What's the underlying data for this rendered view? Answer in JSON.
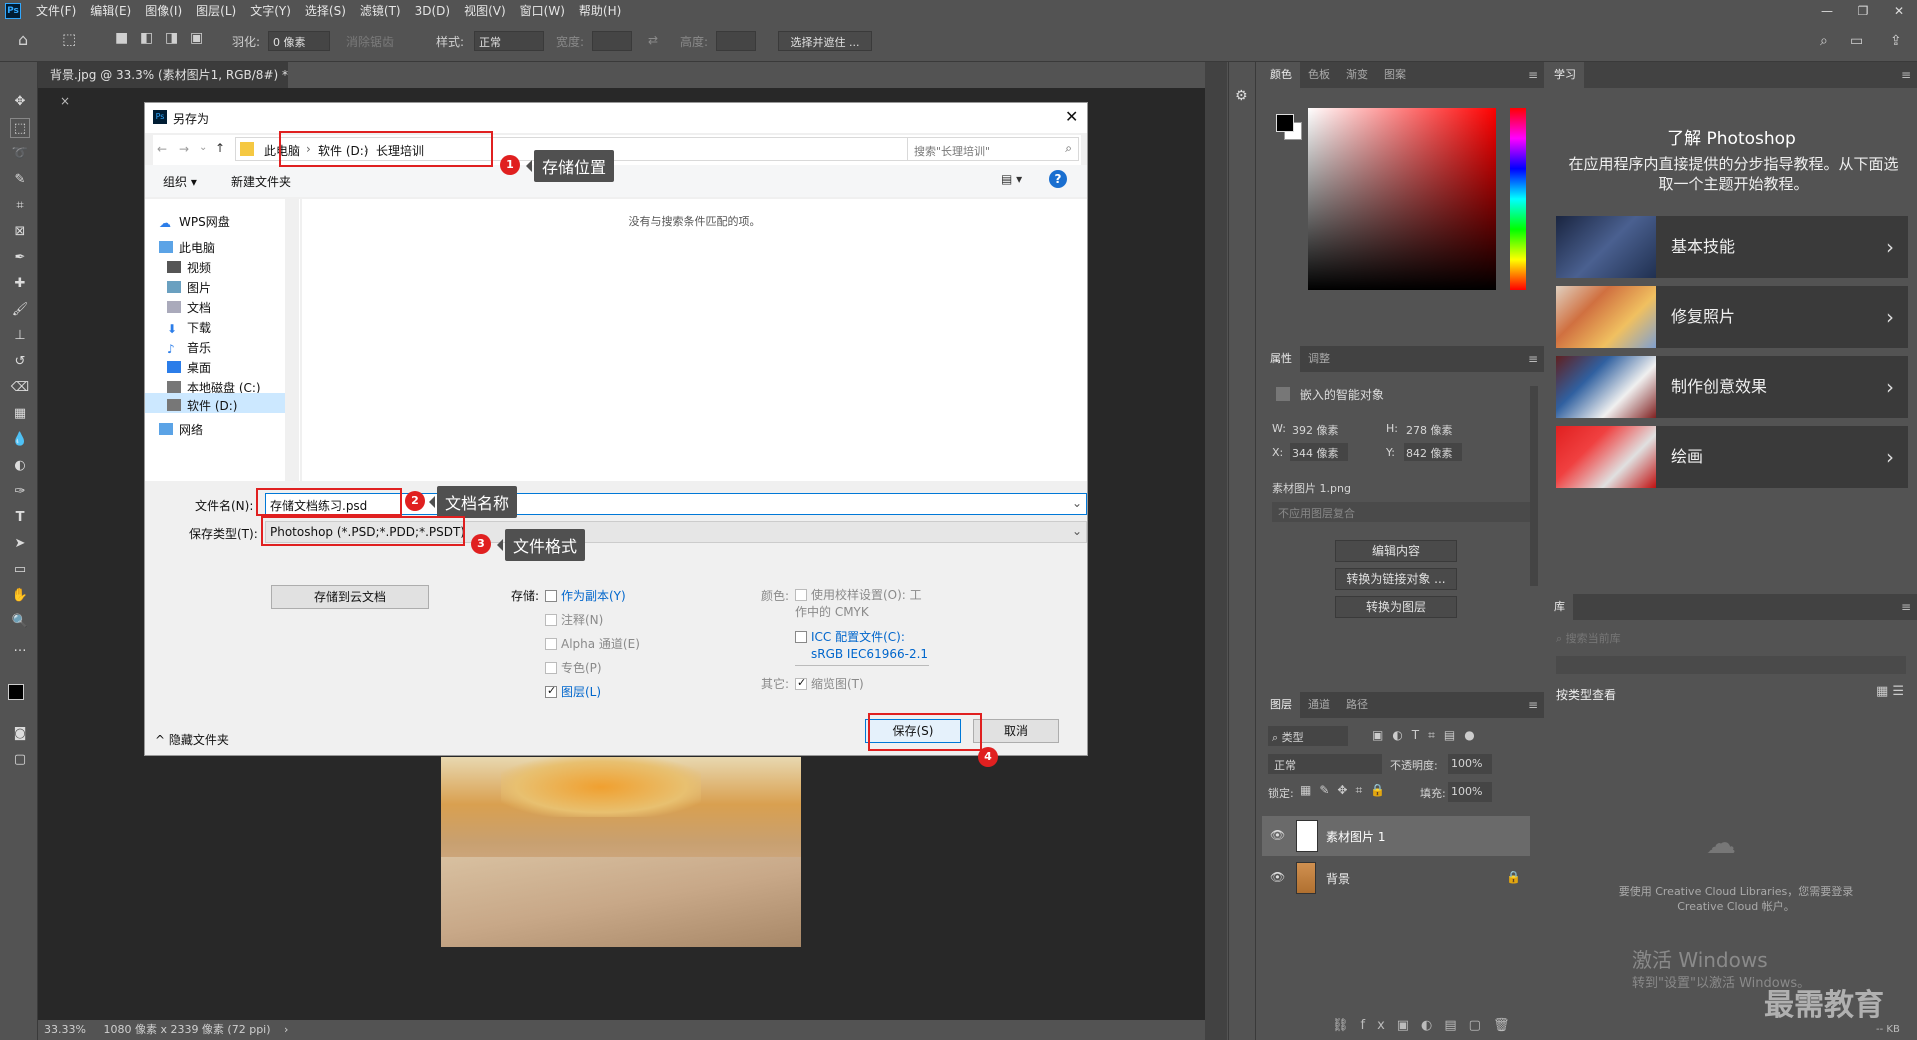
{
  "menubar": {
    "logo": "Ps",
    "items": [
      "文件(F)",
      "编辑(E)",
      "图像(I)",
      "图层(L)",
      "文字(Y)",
      "选择(S)",
      "滤镜(T)",
      "3D(D)",
      "视图(V)",
      "窗口(W)",
      "帮助(H)"
    ]
  },
  "options": {
    "feather_label": "羽化:",
    "feather_value": "0 像素",
    "antialias_label": "消除锯齿",
    "style_label": "样式:",
    "style_value": "正常",
    "width_label": "宽度:",
    "height_label": "高度:",
    "select_mask_button": "选择并遮住 ..."
  },
  "document": {
    "tab_title": "背景.jpg @ 33.3% (素材图片1, RGB/8#) *",
    "status_zoom": "33.33%",
    "status_info": "1080 像素 x 2339 像素 (72 ppi)"
  },
  "color_panel": {
    "tabs": [
      "颜色",
      "色板",
      "渐变",
      "图案"
    ]
  },
  "properties_panel": {
    "tabs": [
      "属性",
      "调整"
    ],
    "object_type": "嵌入的智能对象",
    "w_label": "W:",
    "w_value": "392 像素",
    "h_label": "H:",
    "h_value": "278 像素",
    "x_label": "X:",
    "x_value": "344 像素",
    "y_label": "Y:",
    "y_value": "842 像素",
    "file_name": "素材图片 1.png",
    "comp_placeholder": "不应用图层复合",
    "edit_content": "编辑内容",
    "convert_linked": "转换为链接对象 ...",
    "convert_layer": "转换为图层"
  },
  "layers_panel": {
    "tabs": [
      "图层",
      "通道",
      "路径"
    ],
    "filter_kind": "类型",
    "blend_mode": "正常",
    "opacity_label": "不透明度:",
    "opacity_value": "100%",
    "lock_label": "锁定:",
    "fill_label": "填充:",
    "fill_value": "100%",
    "layers": [
      {
        "name": "素材图片 1"
      },
      {
        "name": "背景"
      }
    ]
  },
  "learn_panel": {
    "tab": "学习",
    "title": "了解 Photoshop",
    "description": "在应用程序内直接提供的分步指导教程。从下面选取一个主题开始教程。",
    "items": [
      "基本技能",
      "修复照片",
      "制作创意效果",
      "绘画"
    ]
  },
  "library_panel": {
    "tab": "库",
    "search_placeholder": "搜索当前库",
    "view_by": "按类型查看",
    "cc_message": "要使用 Creative Cloud Libraries，您需要登录 Creative Cloud 帐户。",
    "kb": "-- KB"
  },
  "watermark": {
    "activate_title": "激活 Windows",
    "activate_sub": "转到\"设置\"以激活 Windows。",
    "brand": "最需教育"
  },
  "dialog": {
    "title": "另存为",
    "breadcrumb": [
      "此电脑",
      "软件 (D:)",
      "长理培训"
    ],
    "search_placeholder": "搜索\"长理培训\"",
    "organize": "组织 ▾",
    "new_folder": "新建文件夹",
    "empty_message": "没有与搜索条件匹配的项。",
    "nav": [
      {
        "label": "WPS网盘"
      },
      {
        "label": "此电脑"
      },
      {
        "label": "视频"
      },
      {
        "label": "图片"
      },
      {
        "label": "文档"
      },
      {
        "label": "下载"
      },
      {
        "label": "音乐"
      },
      {
        "label": "桌面"
      },
      {
        "label": "本地磁盘 (C:)"
      },
      {
        "label": "软件 (D:)"
      },
      {
        "label": "网络"
      }
    ],
    "filename_label": "文件名(N):",
    "filename_value": "存储文档练习.psd",
    "filetype_label": "保存类型(T):",
    "filetype_value": "Photoshop (*.PSD;*.PDD;*.PSDT)",
    "save_cloud": "存储到云文档",
    "storage_label": "存储:",
    "as_copy": "作为副本(Y)",
    "notes": "注释(N)",
    "alpha": "Alpha 通道(E)",
    "spot": "专色(P)",
    "layers": "图层(L)",
    "color_label": "颜色:",
    "proof_setup": "使用校样设置(O): 工作中的 CMYK",
    "icc": "ICC 配置文件(C):",
    "icc_value": "sRGB IEC61966-2.1",
    "other_label": "其它:",
    "thumbnail": "缩览图(T)",
    "hide_folders": "隐藏文件夹",
    "save": "保存(S)",
    "cancel": "取消"
  },
  "annotations": [
    {
      "num": "1",
      "text": "存储位置"
    },
    {
      "num": "2",
      "text": "文档名称"
    },
    {
      "num": "3",
      "text": "文件格式"
    },
    {
      "num": "4",
      "text": ""
    }
  ]
}
